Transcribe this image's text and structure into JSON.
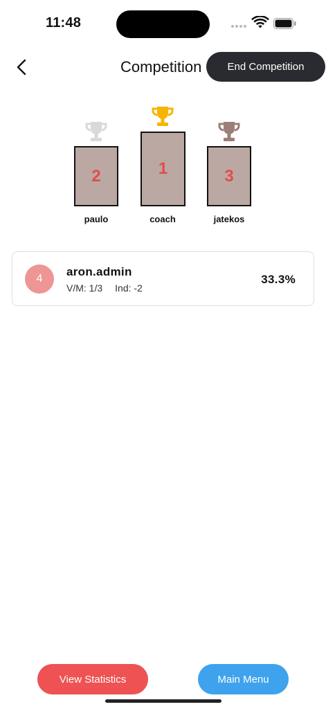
{
  "status_bar": {
    "time": "11:48"
  },
  "header": {
    "title": "Competition",
    "end_button_label": "End Competition"
  },
  "podium": {
    "places": [
      {
        "rank": "2",
        "name": "paulo",
        "trophy": "silver-trophy-icon",
        "color": "#d9d9d9"
      },
      {
        "rank": "1",
        "name": "coach",
        "trophy": "gold-trophy-icon",
        "color": "#f7b500"
      },
      {
        "rank": "3",
        "name": "jatekos",
        "trophy": "bronze-trophy-icon",
        "color": "#9b7f78"
      }
    ]
  },
  "participants": [
    {
      "rank": "4",
      "name": "aron.admin",
      "vm": "V/M: 1/3",
      "ind": "Ind: -2",
      "percent": "33.3%"
    }
  ],
  "footer": {
    "stats_label": "View Statistics",
    "menu_label": "Main Menu"
  },
  "colors": {
    "accent_red": "#ee5252",
    "accent_blue": "#3ea3ec",
    "podium_fill": "#bba8a2",
    "rank_text": "#e14d4e",
    "dark_button": "#2a2b30"
  }
}
